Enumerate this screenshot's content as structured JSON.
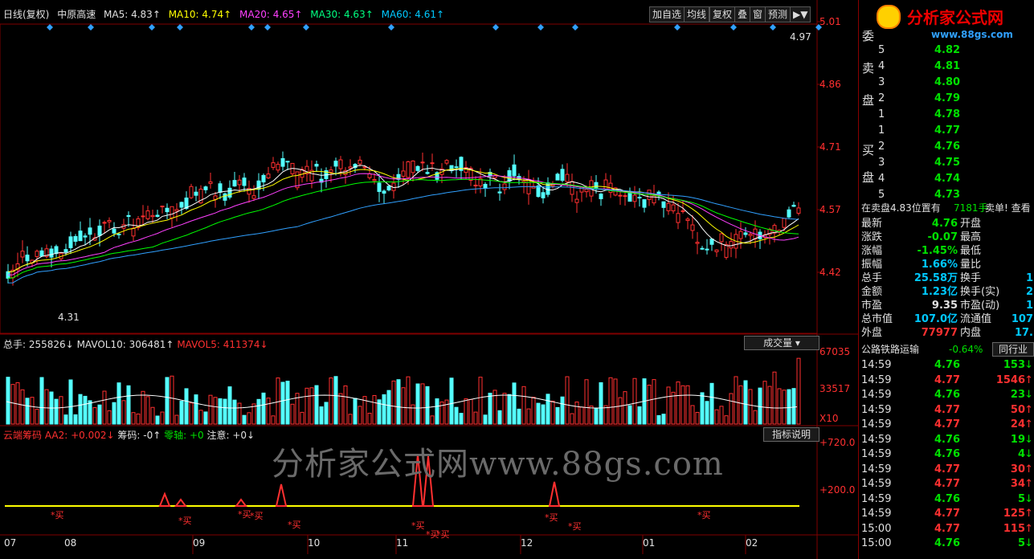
{
  "header": {
    "title": "日线(复权)",
    "stock": "中原高速",
    "ma5": "MA5: 4.83↑",
    "ma10": "MA10: 4.74↑",
    "ma20": "MA20: 4.65↑",
    "ma30": "MA30: 4.63↑",
    "ma60": "MA60: 4.61↑"
  },
  "toolbar": {
    "add_fav": "加自选",
    "avg_line": "均线",
    "fq": "复权",
    "overlay": "叠",
    "window": "窗",
    "forecast": "预测",
    "arrow": "▶▼"
  },
  "logo": {
    "text": "分析家公式网",
    "url": "www.88gs.com"
  },
  "price_axis": [
    "5.01",
    "4.86",
    "4.71",
    "4.57",
    "4.42"
  ],
  "price_marks": {
    "high": "4.97",
    "low": "4.31"
  },
  "volume": {
    "total": "总手: 255826↓",
    "mavol10": "MAVOL10: 306481↑",
    "mavol5": "MAVOL5: 411374↓",
    "menu": "成交量",
    "axis": [
      "67035",
      "33517",
      "X10"
    ]
  },
  "indicator": {
    "name": "云端筹码",
    "aa2": "AA2: +0.002↓",
    "chip": "筹码: -0↑",
    "zero": "零轴: +0",
    "note": "注意: +0↓",
    "help": "指标说明",
    "axis": [
      "+720.0",
      "+200.0"
    ],
    "buy_label": "*买"
  },
  "watermark": "分析家公式网www.88gs.com",
  "months": [
    "07",
    "08",
    "09",
    "10",
    "11",
    "12",
    "01",
    "02"
  ],
  "order_book": {
    "sell_title": [
      "委",
      "卖",
      "盘"
    ],
    "buy_title": [
      "买",
      "盘"
    ],
    "sell": [
      {
        "lvl": "5",
        "price": "4.82"
      },
      {
        "lvl": "4",
        "price": "4.81"
      },
      {
        "lvl": "3",
        "price": "4.80"
      },
      {
        "lvl": "2",
        "price": "4.79"
      },
      {
        "lvl": "1",
        "price": "4.78"
      }
    ],
    "buy": [
      {
        "lvl": "1",
        "price": "4.77"
      },
      {
        "lvl": "2",
        "price": "4.76"
      },
      {
        "lvl": "3",
        "price": "4.75"
      },
      {
        "lvl": "4",
        "price": "4.74"
      },
      {
        "lvl": "5",
        "price": "4.73"
      }
    ]
  },
  "status_line": {
    "left": "在卖盘4.83位置有",
    "mid": "7181手",
    "right": "卖单! 查看"
  },
  "quote": [
    {
      "k": "最新",
      "v": "4.76",
      "k2": "开盘",
      "v2": ""
    },
    {
      "k": "涨跌",
      "v": "-0.07",
      "k2": "最高",
      "v2": ""
    },
    {
      "k": "涨幅",
      "v": "-1.45%",
      "k2": "最低",
      "v2": ""
    },
    {
      "k": "振幅",
      "v": "1.66%",
      "k2": "量比",
      "v2": ""
    },
    {
      "k": "总手",
      "v": "25.58万",
      "k2": "换手",
      "v2": "1"
    },
    {
      "k": "金额",
      "v": "1.23亿",
      "k2": "换手(实)",
      "v2": "2"
    },
    {
      "k": "市盈",
      "v": "9.35",
      "k2": "市盈(动)",
      "v2": "1"
    },
    {
      "k": "总市值",
      "v": "107.0亿",
      "k2": "流通值",
      "v2": "107"
    },
    {
      "k": "外盘",
      "v": "77977",
      "k2": "内盘",
      "v2": "17."
    }
  ],
  "sector": {
    "name": "公路铁路运输",
    "change": "-0.64%",
    "btn": "同行业"
  },
  "ticks": [
    {
      "t": "14:59",
      "p": "4.76",
      "v": "153",
      "d": "↓"
    },
    {
      "t": "14:59",
      "p": "4.77",
      "v": "1546",
      "d": "↑"
    },
    {
      "t": "14:59",
      "p": "4.76",
      "v": "23",
      "d": "↓"
    },
    {
      "t": "14:59",
      "p": "4.77",
      "v": "50",
      "d": "↑"
    },
    {
      "t": "14:59",
      "p": "4.77",
      "v": "24",
      "d": "↑"
    },
    {
      "t": "14:59",
      "p": "4.76",
      "v": "19",
      "d": "↓"
    },
    {
      "t": "14:59",
      "p": "4.76",
      "v": "4",
      "d": "↓"
    },
    {
      "t": "14:59",
      "p": "4.77",
      "v": "30",
      "d": "↑"
    },
    {
      "t": "14:59",
      "p": "4.77",
      "v": "34",
      "d": "↑"
    },
    {
      "t": "14:59",
      "p": "4.76",
      "v": "5",
      "d": "↓"
    },
    {
      "t": "14:59",
      "p": "4.77",
      "v": "125",
      "d": "↑"
    },
    {
      "t": "15:00",
      "p": "4.77",
      "v": "115",
      "d": "↑"
    },
    {
      "t": "15:00",
      "p": "4.76",
      "v": "5",
      "d": "↓"
    }
  ]
}
